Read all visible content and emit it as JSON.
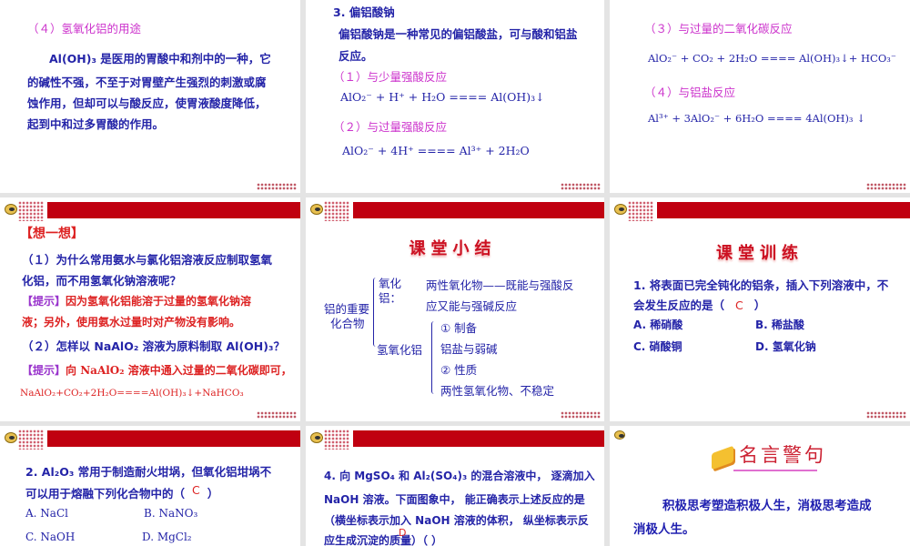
{
  "slides": [
    {
      "heading": "（４）氢氧化铝的用途",
      "lines": [
        "Al(OH)₃ 是医用的胃酸中和剂中的一种，它",
        "的碱性不强，不至于对胃壁产生强烈的刺激或腐",
        "蚀作用，但却可以与酸反应，使胃液酸度降低，",
        "起到中和过多胃酸的作用。"
      ]
    },
    {
      "heading": "3. 偏铝酸钠",
      "lines": [
        "偏铝酸钠是一种常见的偏铝酸盐，可与酸和铝盐",
        "反应。"
      ],
      "sub1": "（１）与少量强酸反应",
      "eq1": "AlO₂⁻ + H⁺ + H₂O ==== Al(OH)₃↓",
      "sub2": "（２）与过量强酸反应",
      "eq2": "AlO₂⁻ + 4H⁺ ==== Al³⁺ + 2H₂O"
    },
    {
      "sub3": "（３）与过量的二氧化碳反应",
      "eq3": "AlO₂⁻ + CO₂ + 2H₂O ==== Al(OH)₃↓+ HCO₃⁻",
      "sub4": "（４）与铝盐反应",
      "eq4": "Al³⁺ + 3AlO₂⁻ + 6H₂O ==== 4Al(OH)₃ ↓"
    },
    {
      "heading": "【想一想】",
      "q1a": "（１）为什么常用氨水与氯化铝溶液反应制取氢氧",
      "q1b": "化铝，而不用氢氧化钠溶液呢？",
      "hint_label": "【提示】",
      "h1a": "因为氢氧化铝能溶于过量的氢氧化钠溶",
      "h1b": "液；另外，使用氨水过量时对产物没有影响。",
      "q2": "（２）怎样以 NaAlO₂ 溶液为原料制取 Al(OH)₃？",
      "h2": "向 NaAlO₂ 溶液中通入过量的二氧化碳即可，",
      "h2eq": "NaAlO₂+CO₂+2H₂O====Al(OH)₃↓+NaHCO₃"
    },
    {
      "title": "课堂小结",
      "root_a": "铝的重要",
      "root_b": "化合物",
      "oxide_a": "氧化",
      "oxide_b": "铝：",
      "oxide_desc_a": "两性氧化物——既能与强酸反",
      "oxide_desc_b": "应又能与强碱反应",
      "hydroxide": "氢氧化铝",
      "items": [
        "① 制备",
        "铝盐与弱碱",
        "② 性质",
        "两性氢氧化物、不稳定"
      ]
    },
    {
      "title": "课堂训练",
      "qa": "1. 将表面已完全钝化的铝条，插入下列溶液中，不",
      "qb": "会发生反应的是（",
      "answer": "C",
      "qc": "）",
      "options": [
        "A. 稀硝酸",
        "B. 稀盐酸",
        "C. 硝酸铜",
        "D. 氢氧化钠"
      ]
    },
    {
      "qa": "2. Al₂O₃ 常用于制造耐火坩埚，但氧化铝坩埚不",
      "qb": "可以用于熔融下列化合物中的（",
      "answer": "C",
      "qc": "）",
      "options": [
        "A. NaCl",
        "B. NaNO₃",
        "C. NaOH",
        "D. MgCl₂"
      ]
    },
    {
      "lines": [
        "4. 向 MgSO₄ 和 Al₂(SO₄)₃ 的混合溶液中，  逐滴加入",
        "NaOH 溶液。下面图象中，  能正确表示上述反应的是",
        "（横坐标表示加入 NaOH 溶液的体积，  纵坐标表示反",
        "应生成沉淀的质量）（    ）"
      ],
      "answer": "D"
    },
    {
      "title": "名言警句",
      "lines": [
        "积极思考塑造积极人生，消极思考造成",
        "消极人生。"
      ]
    }
  ]
}
